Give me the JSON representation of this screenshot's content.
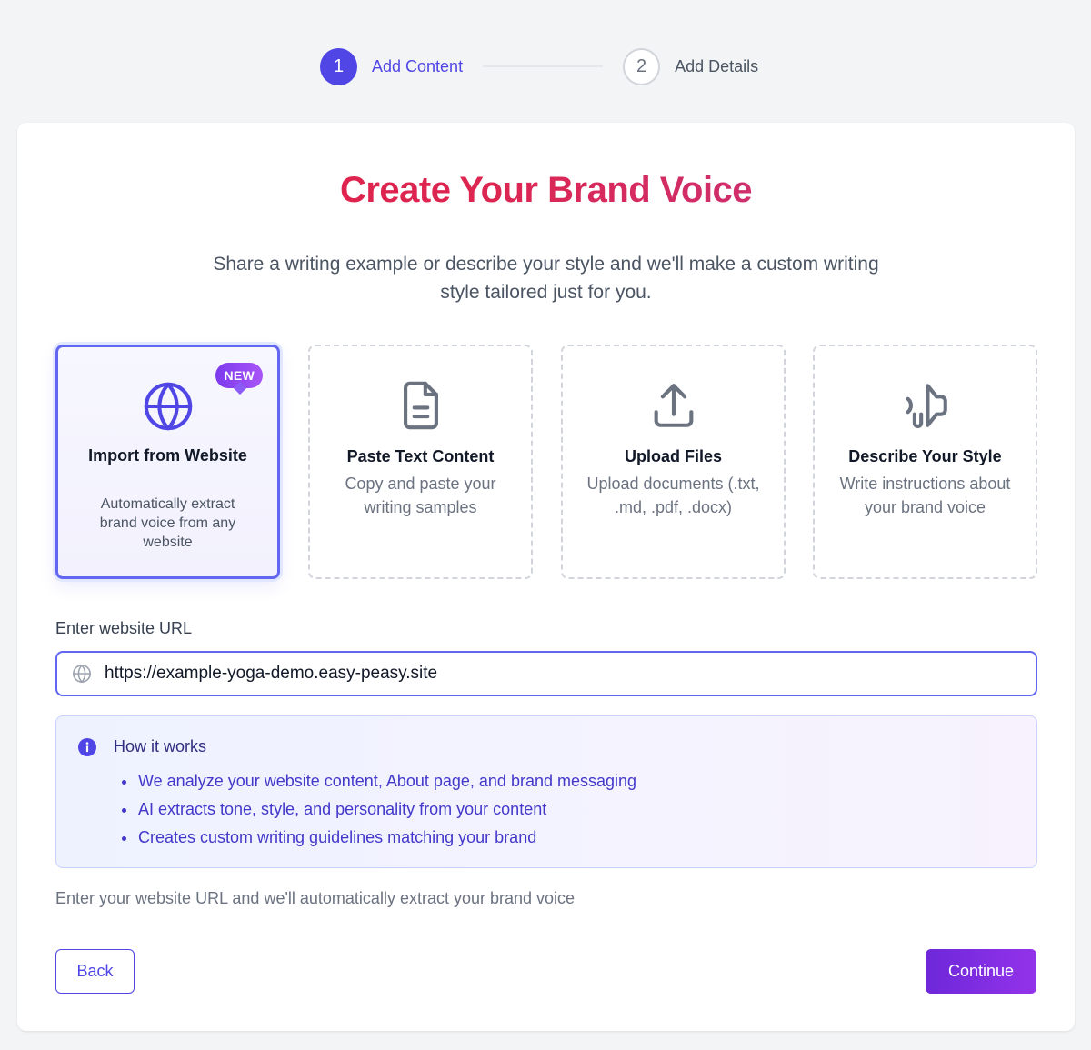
{
  "stepper": {
    "steps": [
      {
        "number": "1",
        "label": "Add Content",
        "state": "active"
      },
      {
        "number": "2",
        "label": "Add Details",
        "state": "inactive"
      }
    ]
  },
  "header": {
    "title": "Create Your Brand Voice",
    "subtitle": "Share a writing example or describe your style and we'll make a custom writing style tailored just for you."
  },
  "options": [
    {
      "title": "Import from Website",
      "description": "Automatically extract brand voice from any website",
      "icon": "globe-icon",
      "badge": "NEW",
      "selected": true
    },
    {
      "title": "Paste Text Content",
      "description": "Copy and paste your writing samples",
      "icon": "document-icon",
      "selected": false
    },
    {
      "title": "Upload Files",
      "description": "Upload documents (.txt, .md, .pdf, .docx)",
      "icon": "upload-icon",
      "selected": false
    },
    {
      "title": "Describe Your Style",
      "description": "Write instructions about your brand voice",
      "icon": "megaphone-icon",
      "selected": false
    }
  ],
  "url_field": {
    "label": "Enter website URL",
    "value": "https://example-yoga-demo.easy-peasy.site",
    "icon": "globe-icon"
  },
  "info": {
    "title": "How it works",
    "icon": "info-icon",
    "items": [
      "We analyze your website content, About page, and brand messaging",
      "AI extracts tone, style, and personality from your content",
      "Creates custom writing guidelines matching your brand"
    ]
  },
  "hint": "Enter your website URL and we'll automatically extract your brand voice",
  "buttons": {
    "back": "Back",
    "continue": "Continue"
  },
  "colors": {
    "accent": "#4f46e5",
    "title_gradient_start": "#e11d48",
    "title_gradient_end": "#be3a8f",
    "continue_gradient_start": "#6d28d9",
    "continue_gradient_end": "#9333ea"
  }
}
